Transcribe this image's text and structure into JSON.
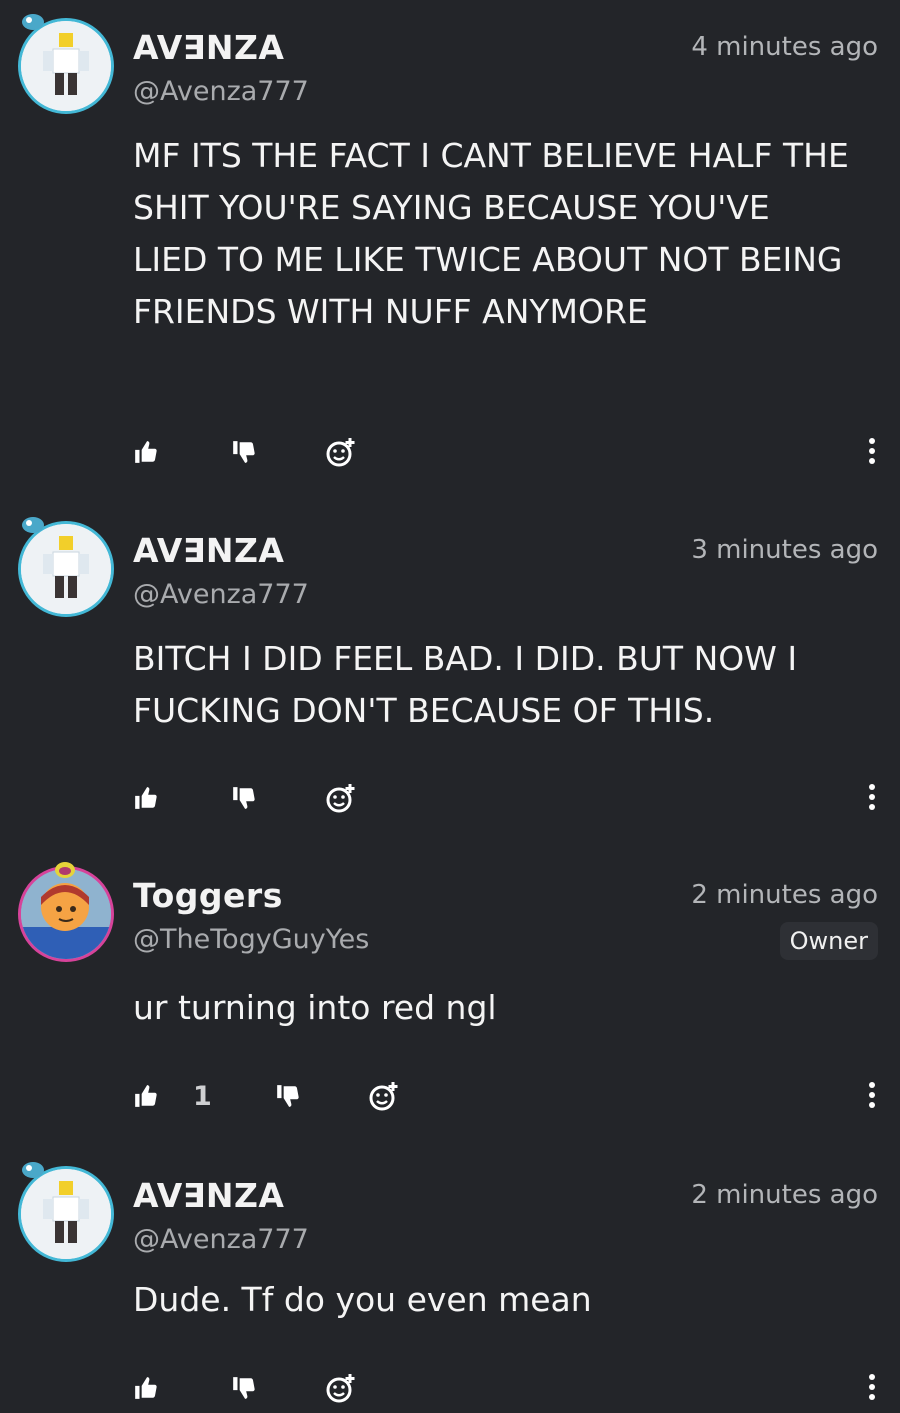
{
  "comments": [
    {
      "name": "AV∃NZA",
      "handle": "@Avenza777",
      "time": "4 minutes ago",
      "text": "MF ITS THE FACT I CANT BELIEVE HALF THE SHIT YOU'RE SAYING BECAUSE YOU'VE LIED TO ME LIKE TWICE ABOUT NOT BEING FRIENDS WITH NUFF ANYMORE",
      "likes": ""
    },
    {
      "name": "AV∃NZA",
      "handle": "@Avenza777",
      "time": "3 minutes ago",
      "text": "BITCH I DID FEEL BAD. I DID. BUT NOW I FUCKING DON'T BECAUSE OF THIS.",
      "likes": ""
    },
    {
      "name": "Toggers",
      "handle": "@TheTogyGuyYes",
      "time": "2 minutes ago",
      "badge": "Owner",
      "text": "ur turning into red ngl",
      "likes": "1"
    },
    {
      "name": "AV∃NZA",
      "handle": "@Avenza777",
      "time": "2 minutes ago",
      "text": "Dude. Tf do you even mean",
      "likes": ""
    }
  ],
  "icons": {
    "like": "thumbs-up-icon",
    "dislike": "thumbs-down-icon",
    "react": "add-reaction-icon",
    "more": "more-vertical-icon"
  },
  "colors": {
    "background": "#232529",
    "avatar_ring_blue": "#43b8d6",
    "avatar_ring_pink": "#d6439a"
  }
}
